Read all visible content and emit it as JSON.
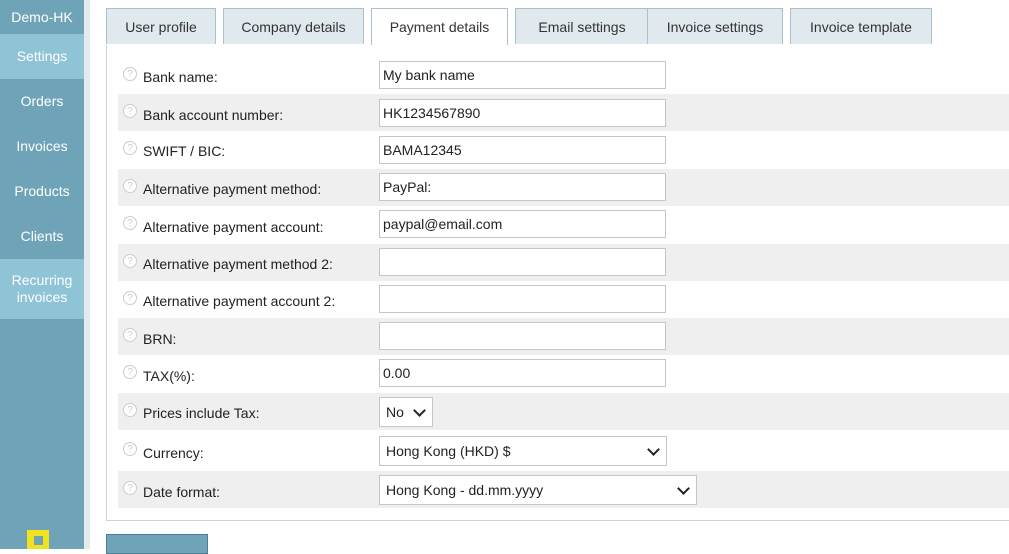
{
  "sidebar": {
    "brand": "Demo-HK",
    "items": [
      {
        "label": "Settings"
      },
      {
        "label": "Orders"
      },
      {
        "label": "Invoices"
      },
      {
        "label": "Products"
      },
      {
        "label": "Clients"
      },
      {
        "label_line1": "Recurring",
        "label_line2": "invoices"
      }
    ]
  },
  "tabs": [
    {
      "label": "User profile"
    },
    {
      "label": "Company details"
    },
    {
      "label": "Payment details"
    },
    {
      "label": "Email settings"
    },
    {
      "label": "Invoice settings"
    },
    {
      "label": "Invoice template"
    }
  ],
  "help_icon_glyph": "?",
  "form": {
    "bank_name": {
      "label": "Bank name:",
      "value": "My bank name"
    },
    "bank_account": {
      "label": "Bank account number:",
      "value": "HK1234567890"
    },
    "swift": {
      "label": "SWIFT / BIC:",
      "value": "BAMA12345"
    },
    "alt_method": {
      "label": "Alternative payment method:",
      "value": "PayPal:"
    },
    "alt_account": {
      "label": "Alternative payment account:",
      "value": "paypal@email.com"
    },
    "alt_method2": {
      "label": "Alternative payment method 2:",
      "value": ""
    },
    "alt_account2": {
      "label": "Alternative payment account 2:",
      "value": ""
    },
    "brn": {
      "label": "BRN:",
      "value": ""
    },
    "tax": {
      "label": "TAX(%):",
      "value": "0.00"
    },
    "prices_include_tax": {
      "label": "Prices include Tax:",
      "value": "No"
    },
    "currency": {
      "label": "Currency:",
      "value": "Hong Kong (HKD) $"
    },
    "date_format": {
      "label": "Date format:",
      "value": "Hong Kong - dd.mm.yyyy"
    }
  },
  "colors": {
    "sidebar": "#6fa4b8",
    "sidebar_active": "#8fc3d6",
    "tab_bg": "#dfe9ee",
    "row_alt": "#efefef",
    "logout_icon": "#f1e21f"
  }
}
